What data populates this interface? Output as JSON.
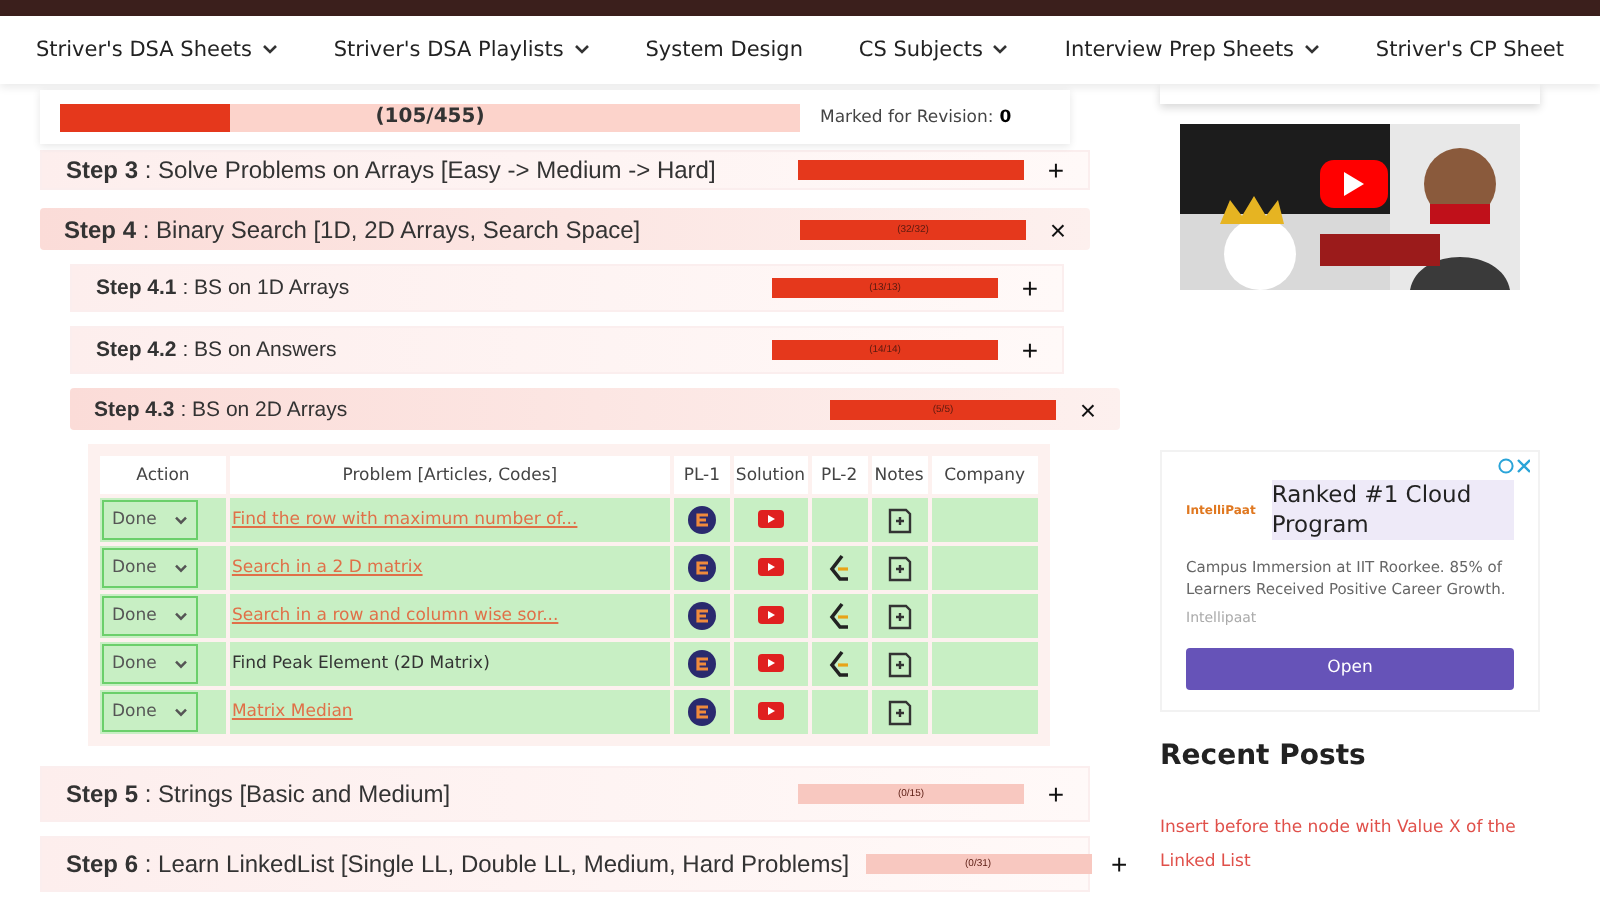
{
  "nav": [
    {
      "label": "Striver's DSA Sheets",
      "dropdown": true
    },
    {
      "label": "Striver's DSA Playlists",
      "dropdown": true
    },
    {
      "label": "System Design",
      "dropdown": false
    },
    {
      "label": "CS Subjects",
      "dropdown": true
    },
    {
      "label": "Interview Prep Sheets",
      "dropdown": true
    },
    {
      "label": "Striver's CP Sheet",
      "dropdown": false
    }
  ],
  "progress": {
    "level": 0.23,
    "count": "(105/455)",
    "revision_label": "Marked for Revision:",
    "revision_count": "0"
  },
  "steps": [
    {
      "number": "Step 3",
      "title": ": Solve Problems on Arrays [Easy -> Medium -> Hard]",
      "level": 1,
      "expanded": false,
      "toggle": "+"
    },
    {
      "number": "Step 4",
      "title": ": Binary Search [1D, 2D Arrays, Search Space]",
      "level": 1,
      "count": "(32/32)",
      "expanded": true,
      "toggle": "×",
      "children": [
        {
          "number": "Step 4.1",
          "title": ": BS on 1D Arrays",
          "level": 1,
          "count": "(13/13)",
          "expanded": false,
          "toggle": "+"
        },
        {
          "number": "Step 4.2",
          "title": ": BS on Answers",
          "level": 1,
          "count": "(14/14)",
          "expanded": false,
          "toggle": "+"
        },
        {
          "number": "Step 4.3",
          "title": ": BS on 2D Arrays",
          "level": 1,
          "count": "(5/5)",
          "expanded": true,
          "toggle": "×",
          "table": {
            "columns": [
              "Action",
              "Problem [Articles, Codes]",
              "PL-1",
              "Solution",
              "PL-2",
              "Notes",
              "Company"
            ],
            "rows": [
              {
                "action": "Done",
                "done": true,
                "problem": "Find the row with maximum number of...",
                "kind": "link",
                "pl1": true,
                "solution": true,
                "pl2": false,
                "notes": true
              },
              {
                "action": "Done",
                "done": true,
                "problem": "Search in a 2 D matrix",
                "kind": "link",
                "pl1": true,
                "solution": true,
                "pl2": true,
                "notes": true
              },
              {
                "action": "Done",
                "done": true,
                "problem": "Search in a row and column wise sor...",
                "kind": "link",
                "pl1": true,
                "solution": true,
                "pl2": true,
                "notes": true
              },
              {
                "action": "Done",
                "done": true,
                "problem": "Find Peak Element (2D Matrix)",
                "kind": "text",
                "pl1": true,
                "solution": true,
                "pl2": true,
                "notes": true
              },
              {
                "action": "Done",
                "done": true,
                "problem": "Matrix Median",
                "kind": "link",
                "pl1": true,
                "solution": true,
                "pl2": false,
                "notes": true
              }
            ]
          }
        }
      ]
    },
    {
      "number": "Step 5",
      "title": ": Strings [Basic and Medium]",
      "level": 0,
      "count": "(0/15)",
      "expanded": false,
      "toggle": "+"
    },
    {
      "number": "Step 6",
      "title": ": Learn LinkedList [Single LL, Double LL, Medium, Hard Problems]",
      "level": 0,
      "count": "(0/31)",
      "expanded": false,
      "toggle": "+"
    }
  ],
  "sidebar": {
    "ad": {
      "brand_logo": "IntelliPaat",
      "headline": "Ranked #1 Cloud Program",
      "body": "Campus Immersion at IIT Roorkee. 85% of Learners Received Positive Career Growth.",
      "advertiser": "Intellipaat",
      "button": "Open"
    },
    "recent_posts": {
      "title": "Recent Posts",
      "items": [
        "Insert before the node with Value X of the Linked List"
      ]
    }
  }
}
